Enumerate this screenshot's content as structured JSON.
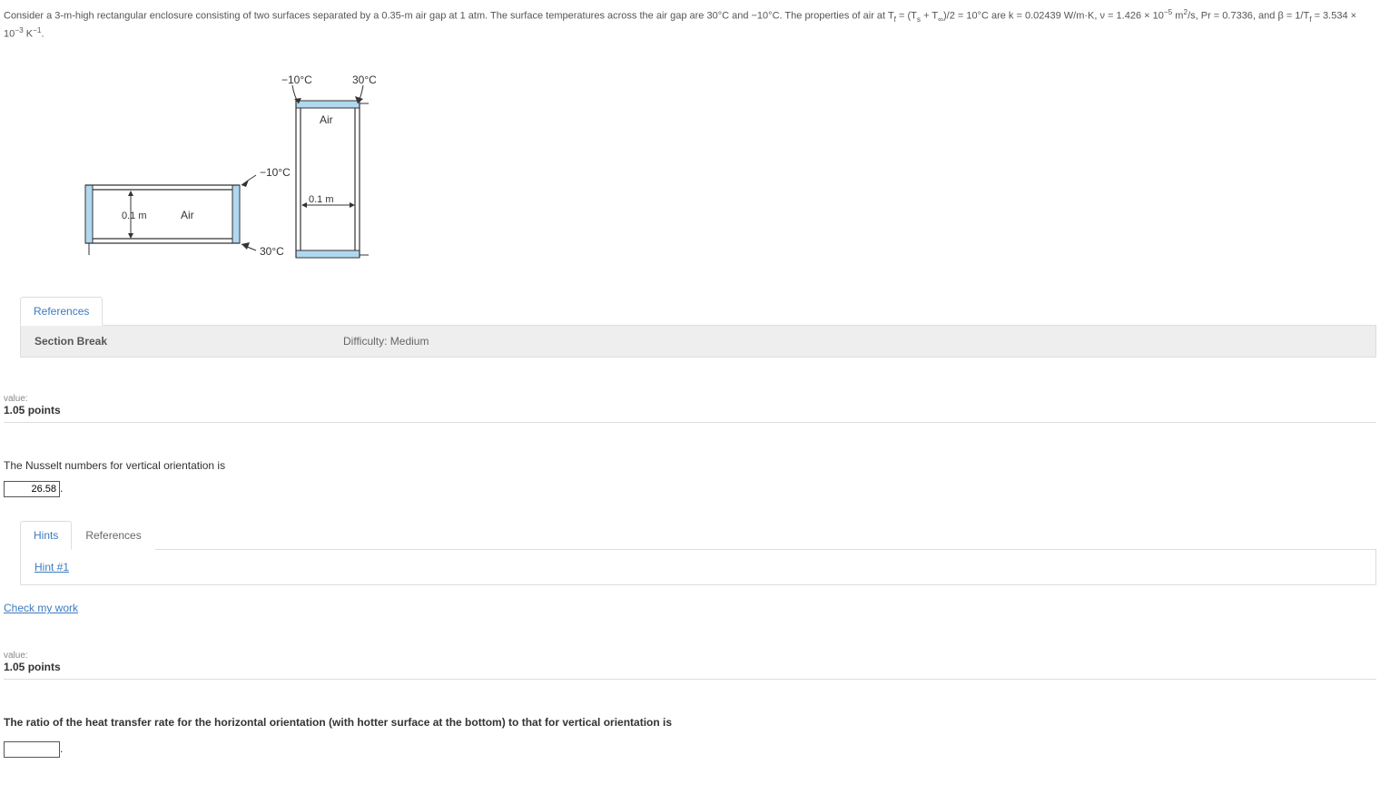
{
  "problem": {
    "text_prefix": "Consider a 3-m-high rectangular enclosure consisting of two surfaces separated by a  0.35-m air gap at 1 atm. The surface temperatures across the air gap are 30°C and −10°C. The properties of air at T",
    "sub_f1": "f",
    "text_eq1": " = (T",
    "sub_s": "s",
    "text_eq2": " + T",
    "sub_inf": "∞",
    "text_eq3": ")/2 = 10°C are k = 0.02439 W/m·K, ν = 1.426 × 10",
    "sup_neg5": "−5",
    "text_eq4": " m",
    "sup_2": "2",
    "text_eq5": "/s, Pr = 0.7336, and β = 1/T",
    "sub_f2": "f",
    "text_eq6": " = 3.534 × 10",
    "sup_neg3": "−3",
    "text_eq7": " K",
    "sup_neg1": "−1",
    "text_period": "."
  },
  "diagram": {
    "label_top_left": "−10°C",
    "label_top_right": "30°C",
    "label_air": "Air",
    "label_h_top": "−10°C",
    "label_h_bottom": "30°C",
    "label_h_dim": "0.1 m",
    "label_h_air": "Air",
    "label_v_dim": "0.1 m"
  },
  "tabs_top": {
    "references": "References"
  },
  "section_break": {
    "label": "Section Break",
    "difficulty": "Difficulty: Medium"
  },
  "q1": {
    "value_label": "value:",
    "points": "1.05 points",
    "text": "The Nusselt numbers for vertical orientation is",
    "answer_value": "26.58",
    "period": ".",
    "tabs": {
      "hints": "Hints",
      "references": "References"
    },
    "hint1": "Hint #1",
    "check": "Check my work"
  },
  "q2": {
    "value_label": "value:",
    "points": "1.05 points",
    "text": "The ratio of the heat transfer rate for the horizontal orientation (with hotter surface at the bottom) to that for vertical orientation is",
    "answer_value": "",
    "period": "."
  }
}
